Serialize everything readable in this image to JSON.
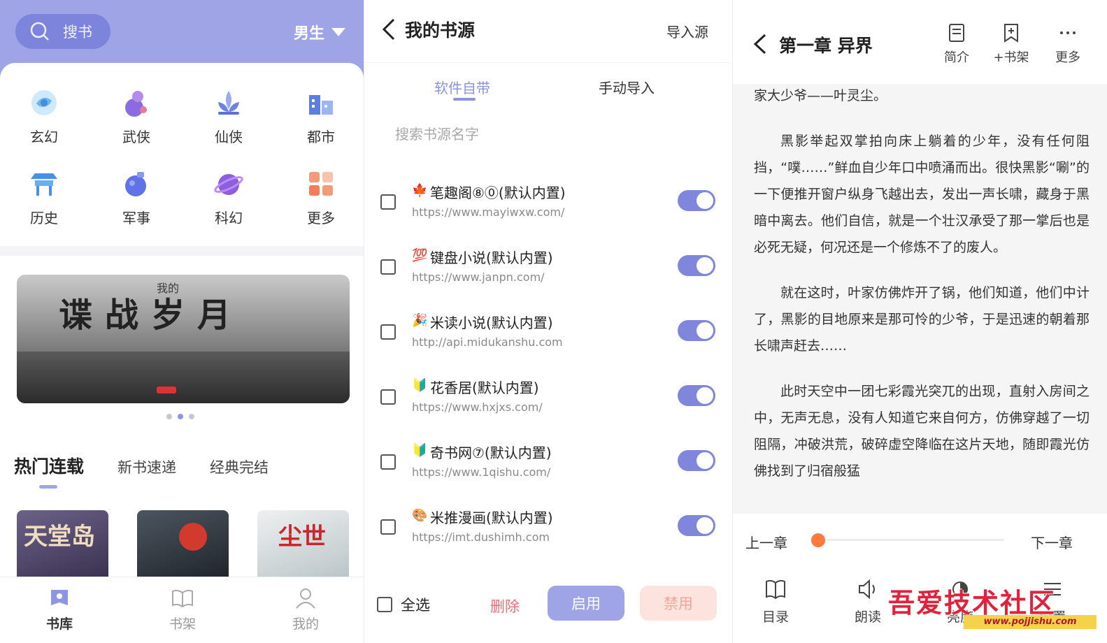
{
  "store": {
    "search_label": "搜书",
    "gender": "男生",
    "categories": [
      {
        "label": "玄幻",
        "icon": "galaxy-icon"
      },
      {
        "label": "武侠",
        "icon": "gourd-icon"
      },
      {
        "label": "仙侠",
        "icon": "lotus-icon"
      },
      {
        "label": "都市",
        "icon": "city-icon"
      },
      {
        "label": "历史",
        "icon": "pavilion-icon"
      },
      {
        "label": "军事",
        "icon": "grenade-icon"
      },
      {
        "label": "科幻",
        "icon": "planet-icon"
      },
      {
        "label": "更多",
        "icon": "grid-icon"
      }
    ],
    "banner": {
      "title": "谍战岁月",
      "sup": "我的"
    },
    "tabs": [
      "热门连载",
      "新书速递",
      "经典完结"
    ],
    "covers": [
      {
        "text": "天堂岛"
      },
      {
        "text": ""
      },
      {
        "text": "尘世"
      }
    ],
    "nav": [
      "书库",
      "书架",
      "我的"
    ]
  },
  "sources": {
    "title": "我的书源",
    "import_label": "导入源",
    "segments": [
      "软件自带",
      "手动导入"
    ],
    "search_placeholder": "搜索书源名字",
    "items": [
      {
        "emoji": "🍁",
        "name": "笔趣阁⑧⓪(默认内置)",
        "url": "https://www.mayiwxw.com/",
        "enabled": true
      },
      {
        "emoji": "💯",
        "name": "键盘小说(默认内置)",
        "url": "https://www.janpn.com/",
        "enabled": true
      },
      {
        "emoji": "🎉",
        "name": "米读小说(默认内置)",
        "url": "http://api.midukanshu.com",
        "enabled": true
      },
      {
        "emoji": "🔰",
        "name": "花香居(默认内置)",
        "url": "https://www.hxjxs.com/",
        "enabled": true
      },
      {
        "emoji": "🔰",
        "name": "奇书网⑦(默认内置)",
        "url": "https://www.1qishu.com/",
        "enabled": true
      },
      {
        "emoji": "🎨",
        "name": "米推漫画(默认内置)",
        "url": "https://imt.dushimh.com",
        "enabled": true
      }
    ],
    "select_all": "全选",
    "delete": "删除",
    "enable": "启用",
    "disable": "禁用"
  },
  "reader": {
    "chapter_title": "第一章 异界",
    "actions": [
      {
        "label": "简介",
        "icon": "info-card-icon"
      },
      {
        "label": "+书架",
        "icon": "bookmark-add-icon"
      },
      {
        "label": "更多",
        "icon": "more-dots-icon"
      }
    ],
    "paragraphs": [
      "家大少爷——叶灵尘。",
      "黑影举起双掌拍向床上躺着的少年，没有任何阻挡，“噗……”鲜血自少年口中喷涌而出。很快黑影“唰”的一下便推开窗户纵身飞越出去，发出一声长啸，藏身于黑暗中离去。他们自信，就是一个壮汉承受了那一掌后也是必死无疑，何况还是一个修炼不了的废人。",
      "就在这时，叶家仿佛炸开了锅，他们知道，他们中计了，黑影的目地原来是那可怜的少爷，于是迅速的朝着那长啸声赶去……",
      "此时天空中一团七彩霞光突兀的出现，直射入房间之中，无声无息，没有人知道它来自何方，仿佛穿越了一切阻隔，冲破洪荒，破碎虚空降临在这片天地，随即霞光仿佛找到了归宿般猛"
    ],
    "prev_chapter": "上一章",
    "next_chapter": "下一章",
    "progress": 0.0,
    "nav": [
      "目录",
      "朗读",
      "亮度",
      "设置"
    ],
    "watermark": "吾爱技术社区",
    "watermark_url": "www.pojjishu.com"
  },
  "colors": {
    "accent": "#9ea4e6",
    "toggle": "#7f86dc",
    "delete": "#e8707a",
    "progress_dot": "#ff7a3d"
  }
}
